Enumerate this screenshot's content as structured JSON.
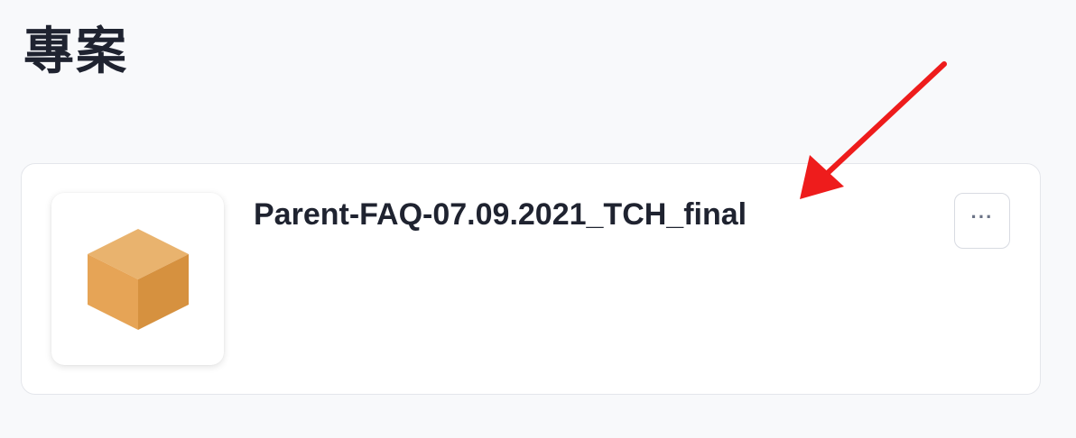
{
  "header": {
    "title": "專案"
  },
  "projects": [
    {
      "name": "Parent-FAQ-07.09.2021_TCH_final",
      "thumbnail_icon": "cube-icon",
      "menu_label": "···"
    }
  ],
  "colors": {
    "background": "#f8f9fb",
    "card": "#ffffff",
    "text": "#1f2330",
    "cube_top": "#e9b36e",
    "cube_left": "#e6a456",
    "cube_right": "#d6913f",
    "annotation_arrow": "#ee1c1c"
  }
}
